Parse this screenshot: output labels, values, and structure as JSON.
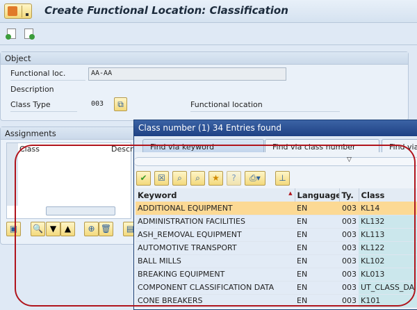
{
  "window": {
    "title": "Create Functional Location: Classification"
  },
  "object": {
    "header": "Object",
    "functional_loc_label": "Functional loc.",
    "functional_loc_value": "AA-AA",
    "description_label": "Description",
    "class_type_label": "Class Type",
    "class_type_value": "003",
    "class_type_text": "Functional location"
  },
  "assignments": {
    "header": "Assignments",
    "columns": [
      "Class",
      "Descri"
    ]
  },
  "popup": {
    "title": "Class number (1)   34 Entries found",
    "tabs": [
      "Find via keyword",
      "Find via class number",
      "Find via"
    ],
    "columns": [
      "Keyword",
      "Language",
      "Ty.",
      "Class"
    ],
    "rows": [
      {
        "keyword": "ADDITIONAL EQUIPMENT",
        "lang": "EN",
        "type": "003",
        "cls": "KL14"
      },
      {
        "keyword": "ADMINISTRATION FACILITIES",
        "lang": "EN",
        "type": "003",
        "cls": "KL132"
      },
      {
        "keyword": "ASH_REMOVAL EQUIPMENT",
        "lang": "EN",
        "type": "003",
        "cls": "KL113"
      },
      {
        "keyword": "AUTOMOTIVE TRANSPORT",
        "lang": "EN",
        "type": "003",
        "cls": "KL122"
      },
      {
        "keyword": "BALL MILLS",
        "lang": "EN",
        "type": "003",
        "cls": "KL102"
      },
      {
        "keyword": "BREAKING EQUIPMENT",
        "lang": "EN",
        "type": "003",
        "cls": "KL013"
      },
      {
        "keyword": "COMPONENT CLASSIFICATION DATA",
        "lang": "EN",
        "type": "003",
        "cls": "UT_CLASS_DA"
      },
      {
        "keyword": "CONE BREAKERS",
        "lang": "EN",
        "type": "003",
        "cls": "K101"
      }
    ]
  },
  "colors": {
    "selected_row": "#fcd994",
    "highlight": "#b0141c",
    "popup_title": "#1f4184"
  }
}
